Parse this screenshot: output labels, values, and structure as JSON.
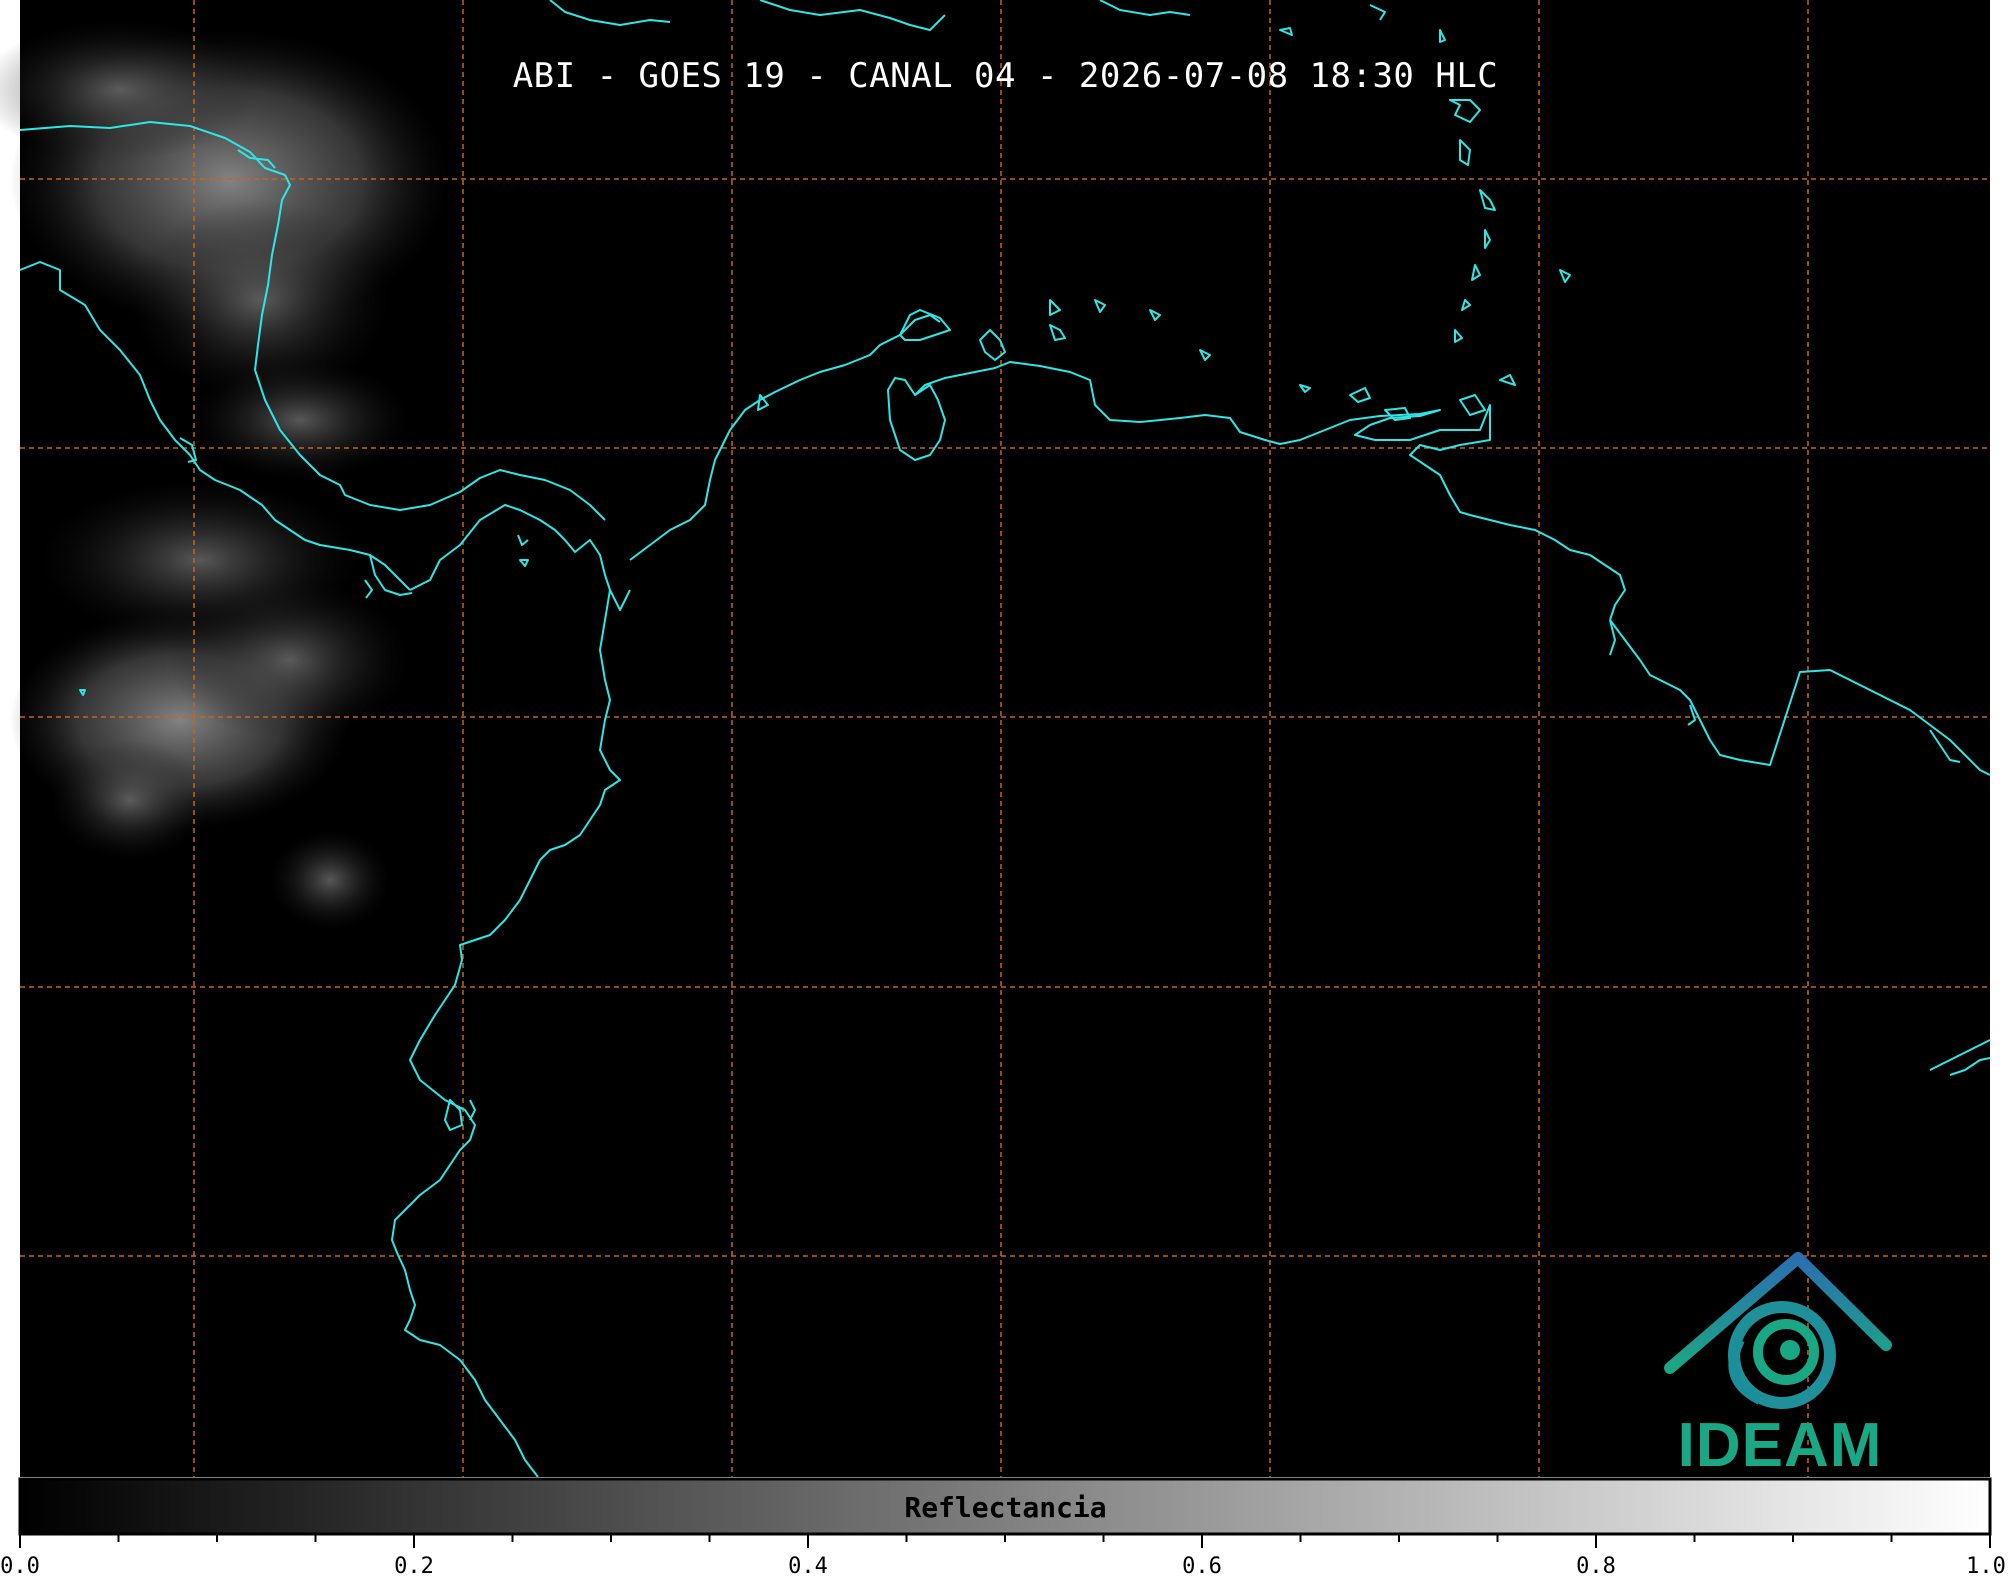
{
  "map": {
    "title": "ABI - GOES 19 - CANAL 04 - 2026-07-08 18:30 HLC",
    "background": "#000000",
    "coastline_color": "#2ee6e6",
    "gridline_color": "#c8641e"
  },
  "colorbar": {
    "label": "Reflectancia",
    "min": 0.0,
    "max": 1.0,
    "colormap": "grayscale",
    "tick_labels": [
      "0.0",
      "0.2",
      "0.4",
      "0.6",
      "0.8",
      "1.0"
    ],
    "tick_values": [
      0.0,
      0.2,
      0.4,
      0.6,
      0.8,
      1.0
    ]
  },
  "logo": {
    "text": "IDEAM",
    "primary_color": "#1aa884",
    "secondary_color": "#2b6fb0"
  }
}
